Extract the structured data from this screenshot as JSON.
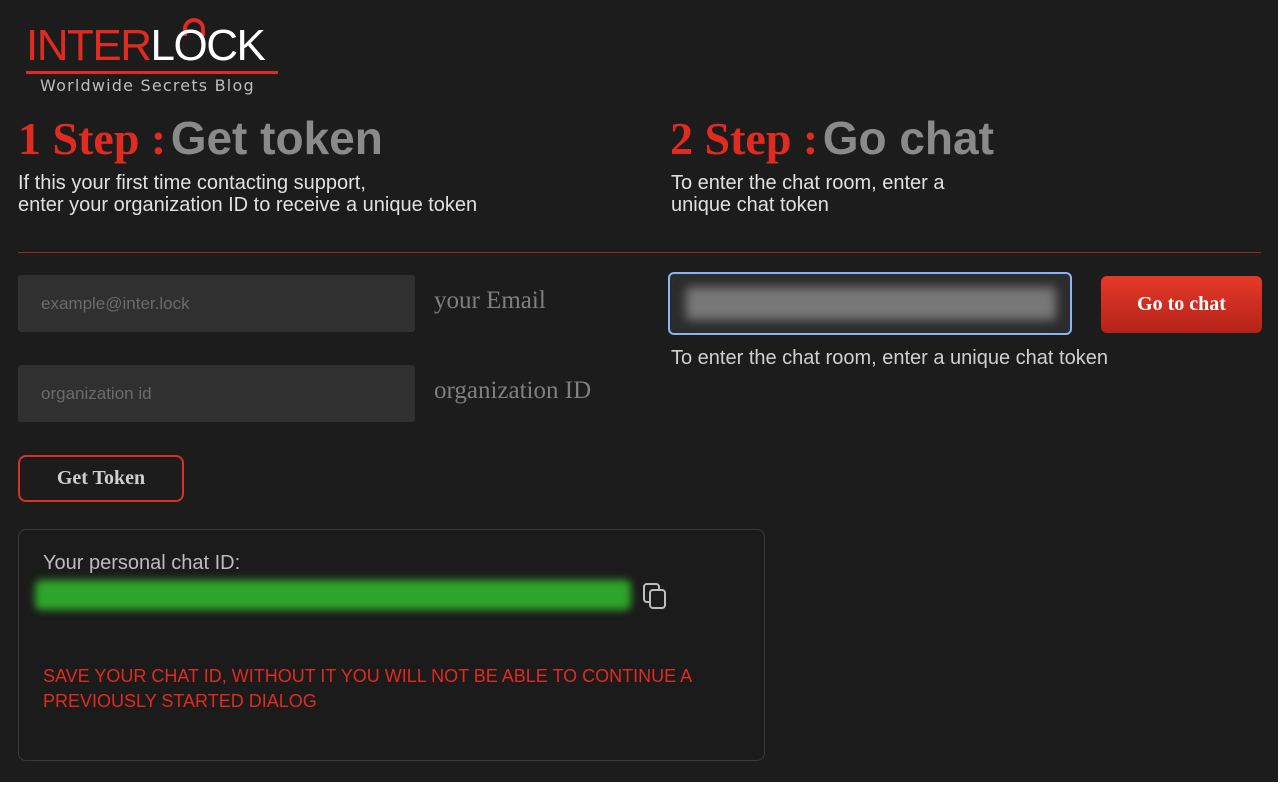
{
  "brand": {
    "logo_text_red": "INTER",
    "logo_text_white": "LOCK",
    "tagline": "Worldwide Secrets Blog",
    "accent_color": "#e02b20"
  },
  "step1": {
    "number": "1 Step :",
    "title": "Get token",
    "description_lines": [
      "If this your first time contacting support,",
      "enter your organization ID to receive a unique token"
    ],
    "email": {
      "placeholder": "example@inter.lock",
      "value": "",
      "label": "your Email"
    },
    "organization": {
      "placeholder": "organization id",
      "value": "",
      "label": "organization ID"
    },
    "button_label": "Get Token"
  },
  "chat_id_panel": {
    "label": "Your personal chat ID:",
    "value_redacted": true,
    "copy_icon": "copy-icon",
    "warning": "SAVE YOUR CHAT ID, WITHOUT IT YOU WILL NOT BE ABLE TO CONTINUE A PREVIOUSLY STARTED DIALOG"
  },
  "step2": {
    "number": "2 Step :",
    "title": "Go chat",
    "description_lines": [
      "To enter the chat room, enter a",
      "unique chat token"
    ],
    "token_input": {
      "value_redacted": true,
      "focused": true,
      "focus_color": "#8ab4f8"
    },
    "button_label": "Go to chat",
    "hint": "To enter the chat room, enter a unique chat token"
  }
}
